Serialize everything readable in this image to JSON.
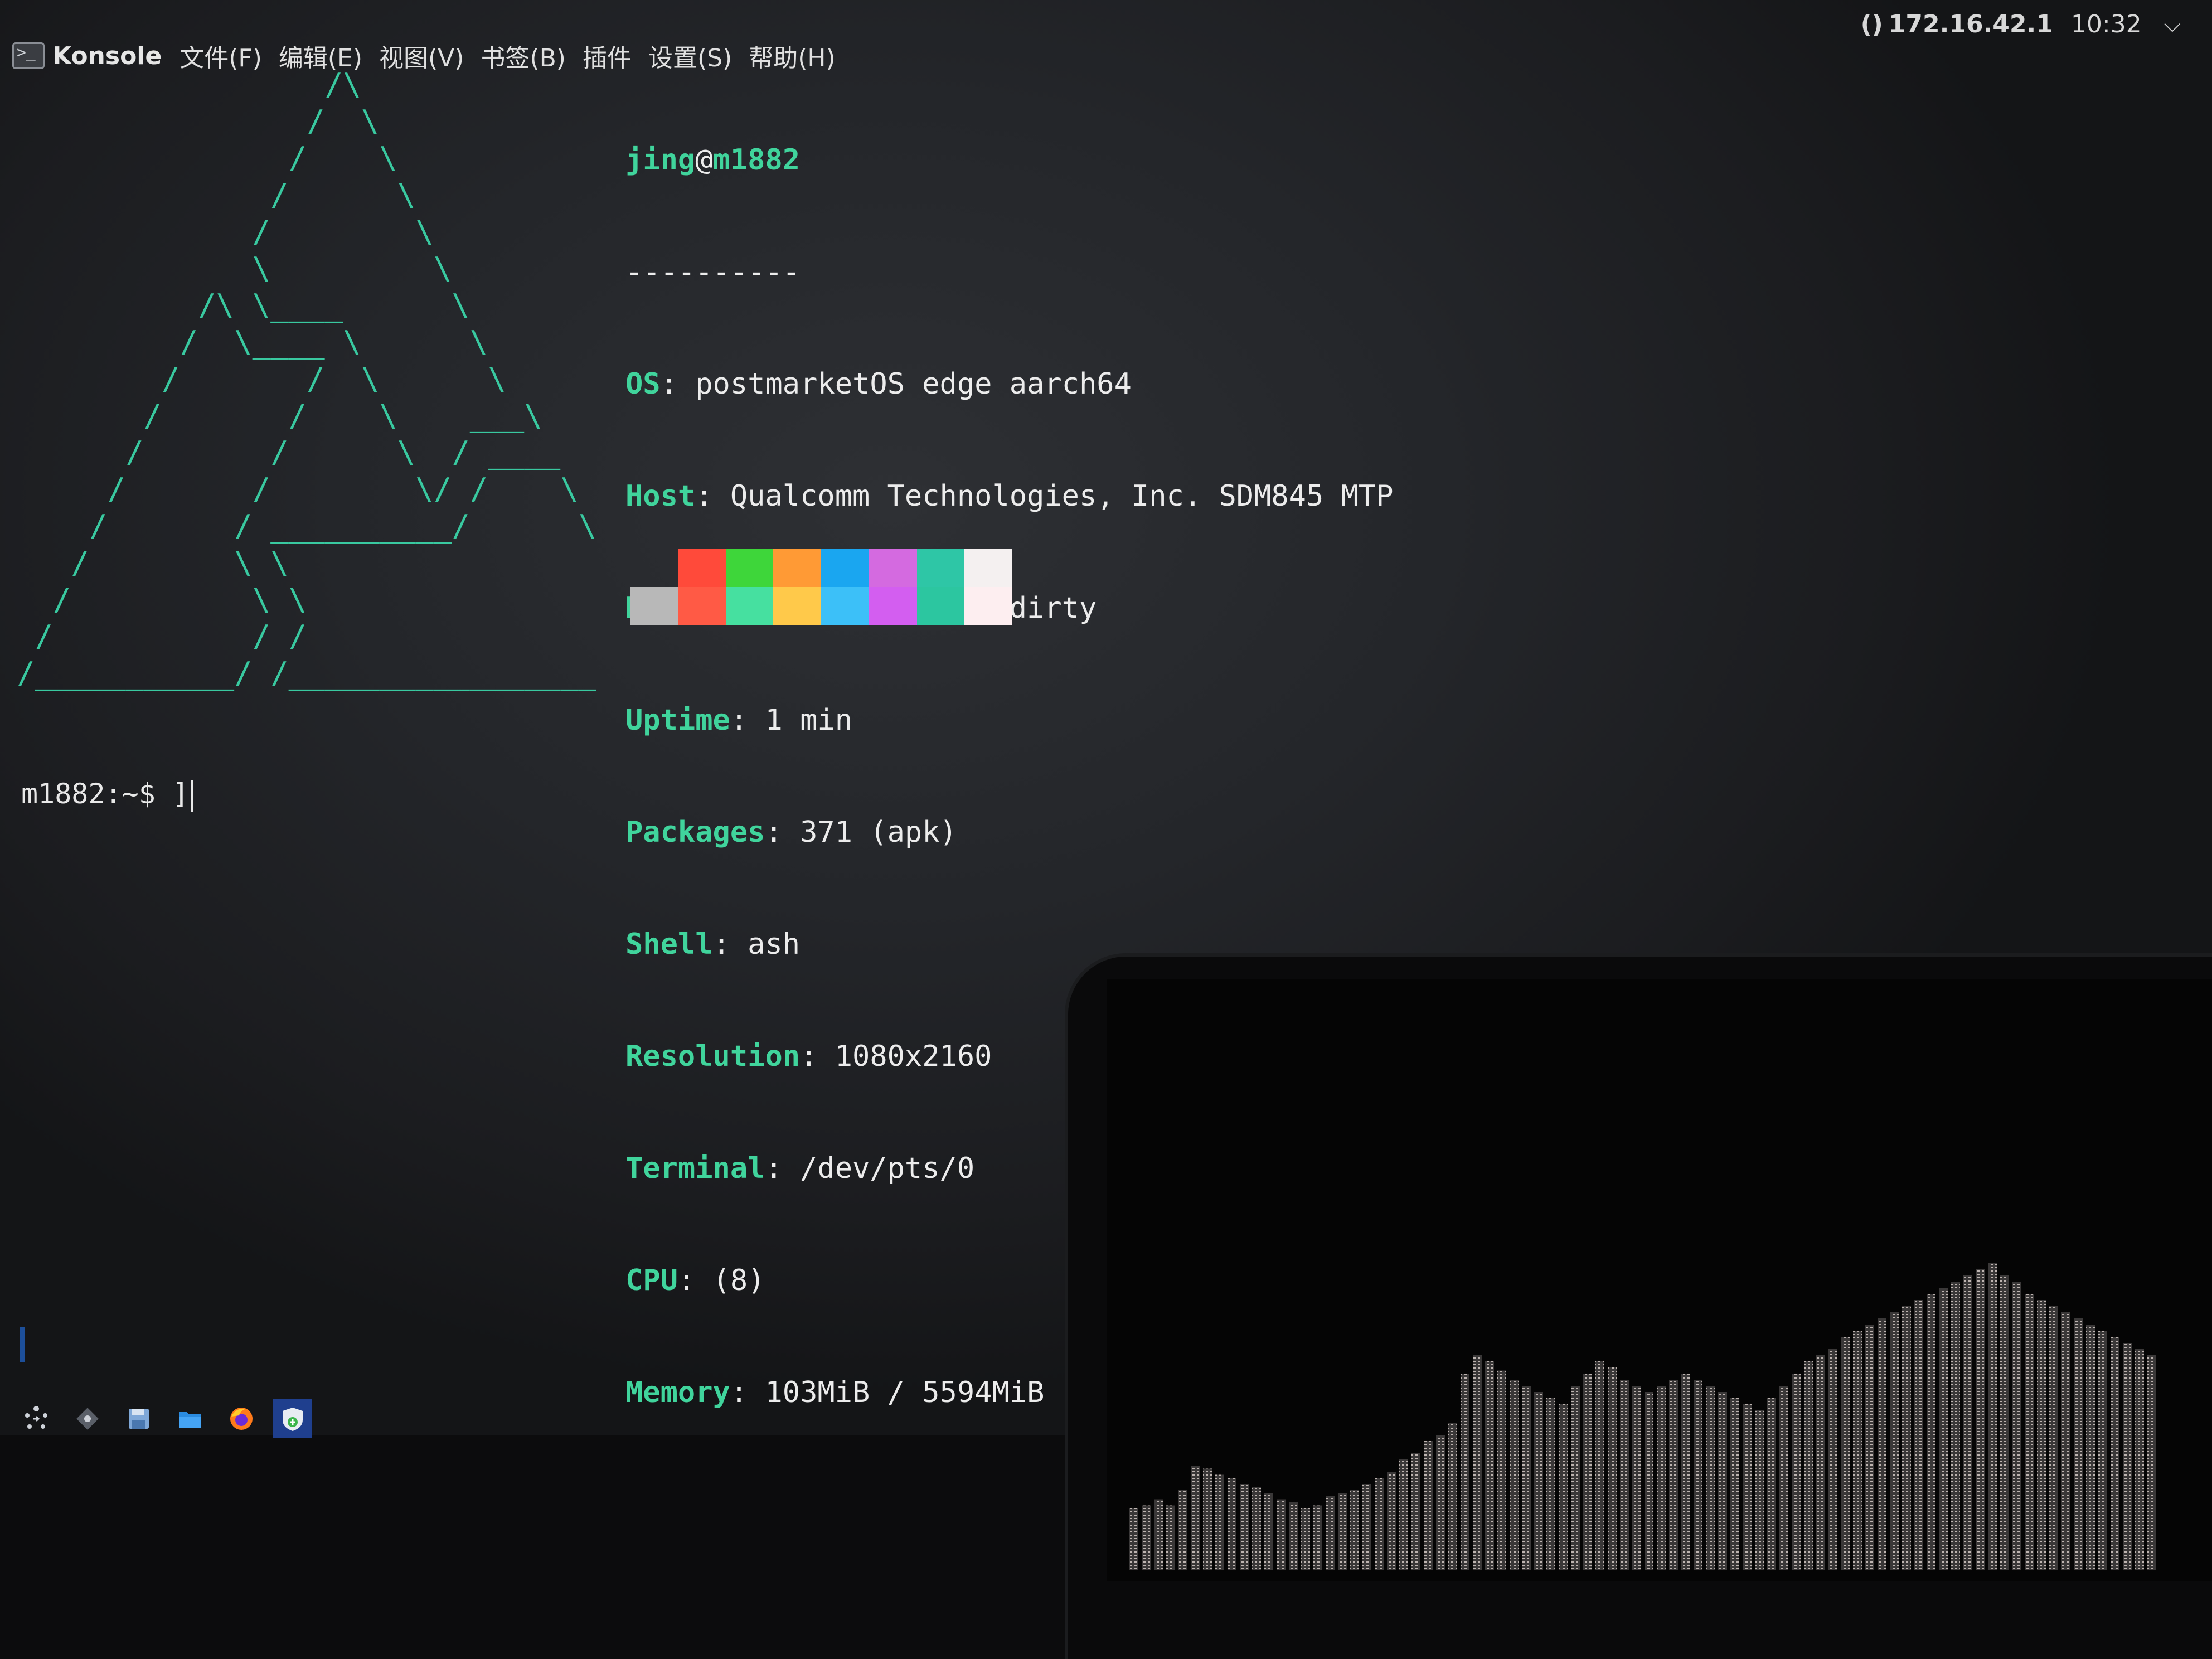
{
  "window": {
    "app_name": "Konsole",
    "menu": [
      "文件(F)",
      "编辑(E)",
      "视图(V)",
      "书签(B)",
      "插件",
      "设置(S)",
      "帮助(H)"
    ]
  },
  "tray": {
    "network_glyph": "()",
    "ip": "172.16.42.1",
    "clock": "10:32",
    "chevron": "⌵"
  },
  "ascii_logo_lines": [
    "                 /\\",
    "                /  \\",
    "               /    \\",
    "              /      \\",
    "             /        \\",
    "             \\         \\",
    "          /\\ \\____      \\",
    "         /  \\____ \\      \\",
    "        /       /  \\      \\",
    "       /       /    \\    ___\\",
    "      /       /      \\  / ____",
    "     /       /        \\/ /    \\",
    "    /       / __________/      \\",
    "   /        \\ \\                 \\",
    "  /          \\ \\                 \\",
    " /           / /                  \\",
    "/___________/ /____________________\\"
  ],
  "neofetch": {
    "user": "jing",
    "at": "@",
    "host": "m1882",
    "separator": "----------",
    "fields": [
      {
        "key": "OS",
        "value": "postmarketOS edge aarch64"
      },
      {
        "key": "Host",
        "value": "Qualcomm Technologies, Inc. SDM845 MTP"
      },
      {
        "key": "Kernel",
        "value": "5.18.3-sdm845-dirty"
      },
      {
        "key": "Uptime",
        "value": "1 min"
      },
      {
        "key": "Packages",
        "value": "371 (apk)"
      },
      {
        "key": "Shell",
        "value": "ash"
      },
      {
        "key": "Resolution",
        "value": "1080x2160"
      },
      {
        "key": "Terminal",
        "value": "/dev/pts/0"
      },
      {
        "key": "CPU",
        "value": "(8)"
      },
      {
        "key": "Memory",
        "value": "103MiB / 5594MiB"
      }
    ],
    "palette_top": [
      "transparent",
      "#ff4a3a",
      "#3ed63a",
      "#ff9a35",
      "#1aa6f0",
      "#d46ae0",
      "#2ec6a6",
      "#f4f0f0"
    ],
    "palette_bottom": [
      "#b8b8b8",
      "#ff5a45",
      "#46e0a0",
      "#ffc94a",
      "#3cc0f8",
      "#d35ef0",
      "#2cc6a0",
      "#fdeef0"
    ]
  },
  "prompt": {
    "text": "m1882:~$ ]"
  },
  "taskbar": {
    "icons": [
      "app-launcher-icon",
      "discover-icon",
      "save-icon",
      "file-manager-icon",
      "firefox-icon",
      "konsole-task-icon"
    ]
  }
}
